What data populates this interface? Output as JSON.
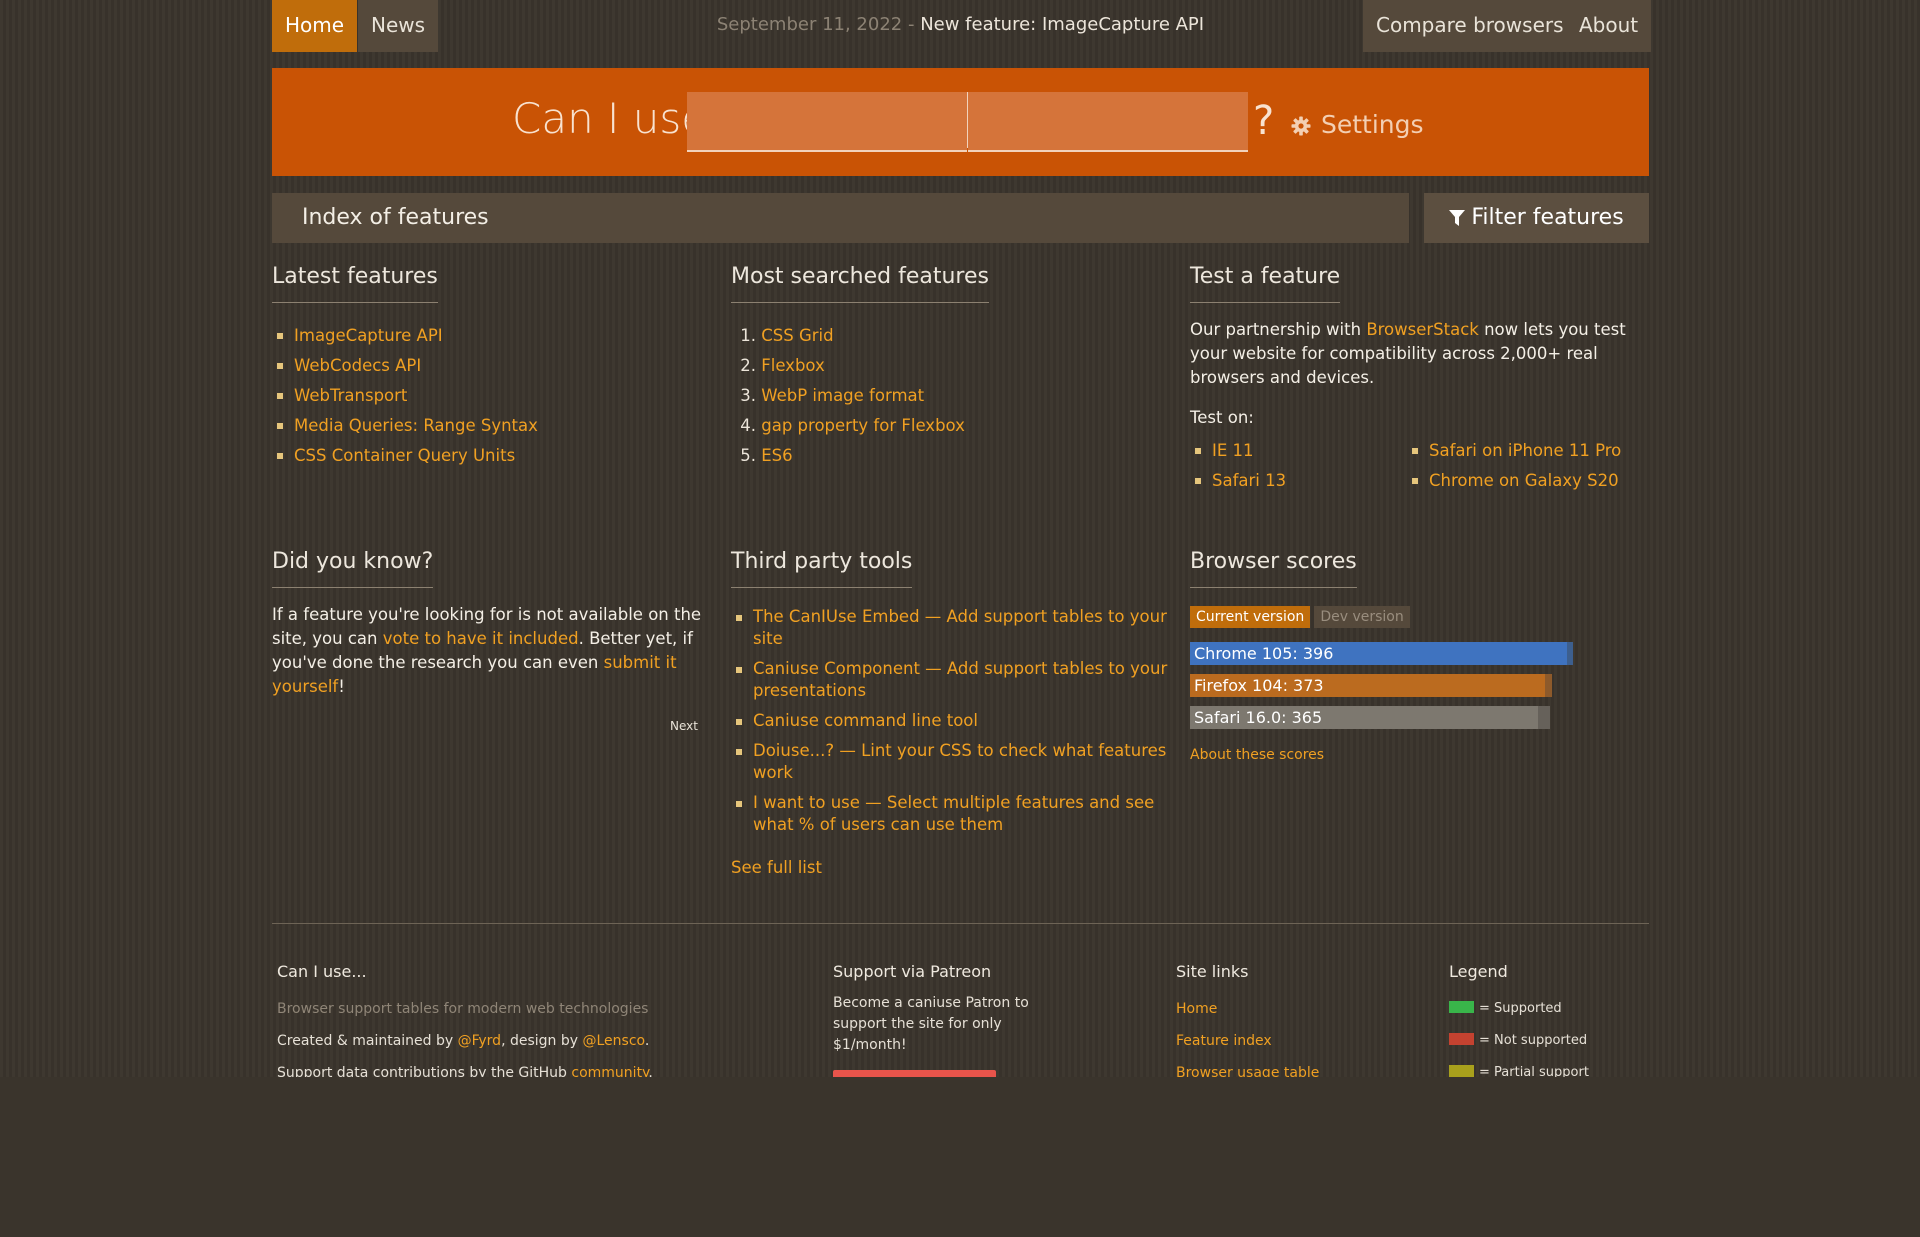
{
  "nav": {
    "home": "Home",
    "news": "News",
    "news_date": "September 11, 2022 -",
    "news_title": "New feature: ImageCapture API",
    "compare": "Compare browsers",
    "about": "About"
  },
  "search": {
    "prefix": "Can I use",
    "suffix": "?",
    "settings": "Settings"
  },
  "index_bar": {
    "title": "Index of features",
    "filter": "Filter features"
  },
  "latest": {
    "title": "Latest features",
    "items": [
      "ImageCapture API",
      "WebCodecs API",
      "WebTransport",
      "Media Queries: Range Syntax",
      "CSS Container Query Units"
    ]
  },
  "most_searched": {
    "title": "Most searched features",
    "items": [
      "CSS Grid",
      "Flexbox",
      "WebP image format",
      "gap property for Flexbox",
      "ES6"
    ]
  },
  "test": {
    "title": "Test a feature",
    "text_before": "Our partnership with ",
    "link": "BrowserStack",
    "text_after": " now lets you test your website for compatibility across 2,000+ real browsers and devices.",
    "test_on": "Test on:",
    "targets": [
      "IE 11",
      "Safari 13",
      "Safari on iPhone 11 Pro",
      "Chrome on Galaxy S20"
    ]
  },
  "did_you_know": {
    "title": "Did you know?",
    "t1": "If a feature you're looking for is not available on the site, you can ",
    "l1": "vote to have it included",
    "t2": ". Better yet, if you've done the research you can even ",
    "l2": "submit it yourself",
    "t3": "!",
    "next": "Next"
  },
  "tools": {
    "title": "Third party tools",
    "items": [
      "The CanIUse Embed — Add support tables to your site",
      "Caniuse Component — Add support tables to your presentations",
      "Caniuse command line tool",
      "Doiuse...? — Lint your CSS to check what features work",
      "I want to use — Select multiple features and see what % of users can use them"
    ],
    "see_full": "See full list"
  },
  "scores": {
    "title": "Browser scores",
    "current": "Current version",
    "dev": "Dev version",
    "bars": [
      {
        "label": "Chrome 105: 396",
        "value": 396,
        "dev_value": 402,
        "color": "#3f73c0",
        "track": "#3d5f8e"
      },
      {
        "label": "Firefox 104: 373",
        "value": 373,
        "dev_value": 380,
        "color": "#bb6b1f",
        "track": "#8d5a2b"
      },
      {
        "label": "Safari 16.0: 365",
        "value": 365,
        "dev_value": 378,
        "color": "#7d786f",
        "track": "#66615a"
      }
    ],
    "max": 420,
    "about": "About these scores"
  },
  "footer": {
    "title": "Can I use...",
    "tagline": "Browser support tables for modern web technologies",
    "created_pre": "Created & maintained by ",
    "created_link1": "@Fyrd",
    "created_mid": ", design by ",
    "created_link2": "@Lensco",
    "created_end": ".",
    "contrib_pre": "Support data contributions by the GitHub ",
    "contrib_link": "community",
    "contrib_end": ".",
    "patreon_title": "Support via Patreon",
    "patreon_text": "Become a caniuse Patron to support the site for only $1/month!",
    "links_title": "Site links",
    "links": [
      "Home",
      "Feature index",
      "Browser usage table"
    ],
    "legend_title": "Legend",
    "legend": [
      {
        "label": "= Supported",
        "color": "#39b54a"
      },
      {
        "label": "= Not supported",
        "color": "#c44230"
      },
      {
        "label": "= Partial support",
        "color": "#a8a01c"
      }
    ]
  }
}
